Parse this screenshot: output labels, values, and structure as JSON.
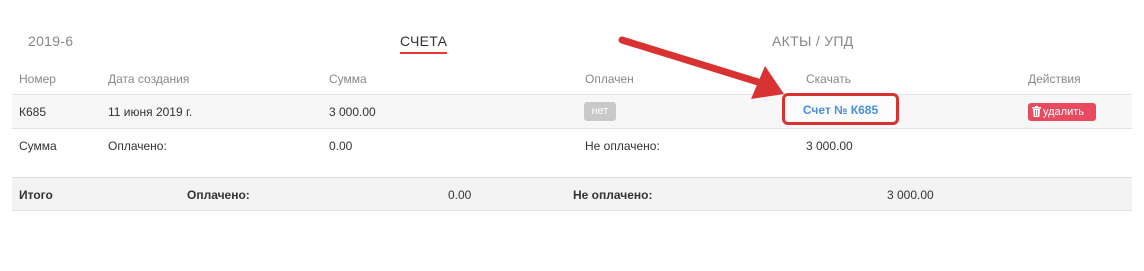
{
  "tabs": {
    "period": "2019-6",
    "invoices": "СЧЕТА",
    "acts": "АКТЫ / УПД"
  },
  "table": {
    "headers": {
      "number": "Номер",
      "created": "Дата создания",
      "sum": "Сумма",
      "paid": "Оплачен",
      "download": "Скачать",
      "actions": "Действия"
    },
    "row": {
      "number": "К685",
      "created": "11 июня 2019 г.",
      "sum": "3 000.00",
      "paid_badge": "нет",
      "download_link": "Счет № К685",
      "delete_label": "удалить"
    },
    "summary": {
      "label": "Сумма",
      "paid_label": "Оплачено:",
      "paid_value": "0.00",
      "unpaid_label": "Не оплачено:",
      "unpaid_value": "3 000.00"
    }
  },
  "totals": {
    "label": "Итого",
    "paid_label": "Оплачено:",
    "paid_value": "0.00",
    "unpaid_label": "Не оплачено:",
    "unpaid_value": "3 000.00"
  },
  "colors": {
    "accent_red": "#d93232",
    "link_blue": "#4a90d9",
    "delete_bg": "#e84a5f",
    "badge_gray": "#c9c9c9"
  },
  "icons": {
    "delete": "trash-icon",
    "annotation": "red-arrow"
  }
}
